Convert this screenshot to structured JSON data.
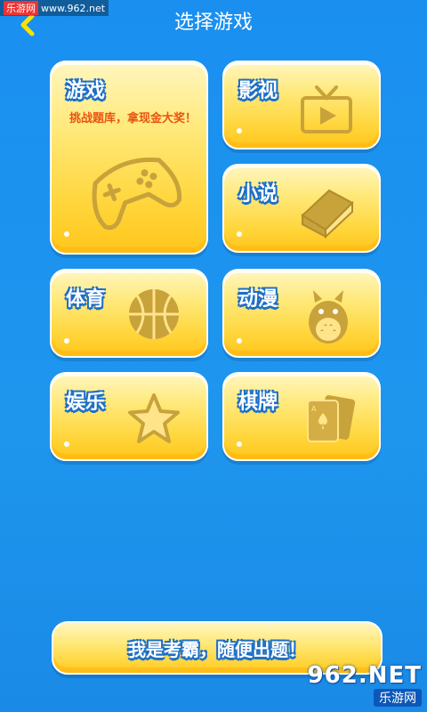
{
  "watermark_top": {
    "brand": "乐游网",
    "url": "www.962.net"
  },
  "header": {
    "title": "选择游戏"
  },
  "cards": {
    "games": {
      "label": "游戏",
      "subtitle": "挑战题库，拿现金大奖！"
    },
    "film": {
      "label": "影视"
    },
    "novel": {
      "label": "小说"
    },
    "sports": {
      "label": "体育"
    },
    "anime": {
      "label": "动漫"
    },
    "entertainment": {
      "label": "娱乐"
    },
    "chess": {
      "label": "棋牌"
    }
  },
  "bottom_button": {
    "label": "我是考霸，随便出题！"
  },
  "watermark_bottom": {
    "logo": "962.NET",
    "brand": "乐游网"
  },
  "colors": {
    "background": "#1a8ff0",
    "card": "#ffd53a",
    "label_outline": "#1d6fc7",
    "subtitle": "#e8540f"
  },
  "icons": [
    "back-arrow-icon",
    "gamepad-icon",
    "tv-icon",
    "book-icon",
    "basketball-icon",
    "totoro-icon",
    "star-icon",
    "playing-cards-icon"
  ]
}
